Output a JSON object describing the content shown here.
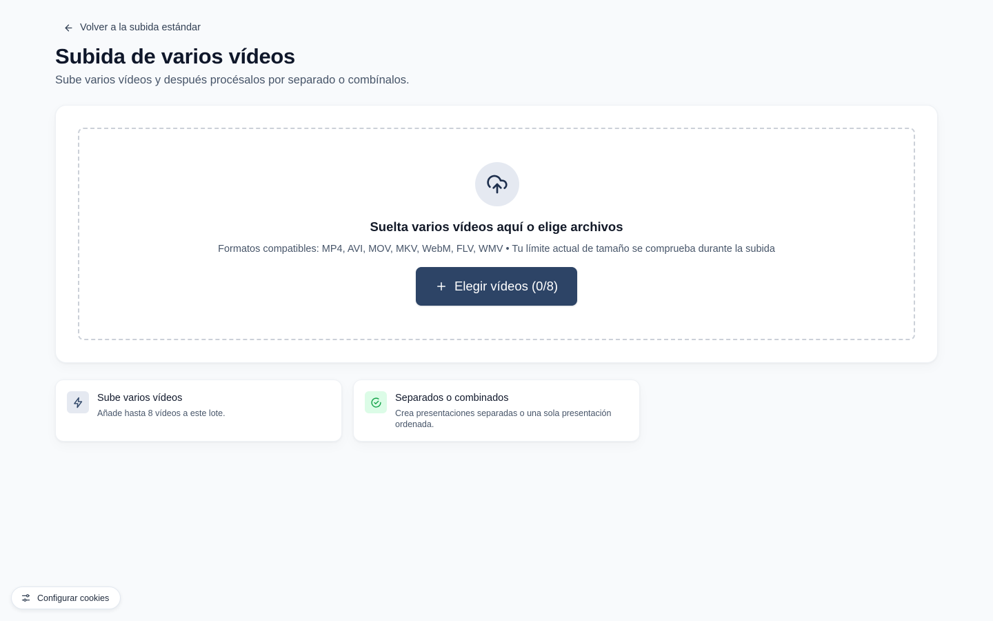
{
  "header": {
    "back_label": "Volver a la subida estándar",
    "title": "Subida de varios vídeos",
    "subtitle": "Sube varios vídeos y después procésalos por separado o combínalos."
  },
  "upload": {
    "icon": "cloud-upload-icon",
    "title": "Suelta varios vídeos aquí o elige archivos",
    "formats": "Formatos compatibles: MP4, AVI, MOV, MKV, WebM, FLV, WMV • Tu límite actual de tamaño se comprueba durante la subida",
    "button_label": "Elegir vídeos (0/8)",
    "button_icon": "plus-icon",
    "button_color": "#2d4466"
  },
  "features": [
    {
      "icon": "lightning-icon",
      "title": "Sube varios vídeos",
      "description": "Añade hasta 8 vídeos a este lote."
    },
    {
      "icon": "check-circle-icon",
      "title": "Separados o combinados",
      "description": "Crea presentaciones separadas o una sola presentación ordenada."
    }
  ],
  "cookies": {
    "label": "Configurar cookies",
    "icon": "sliders-icon"
  }
}
